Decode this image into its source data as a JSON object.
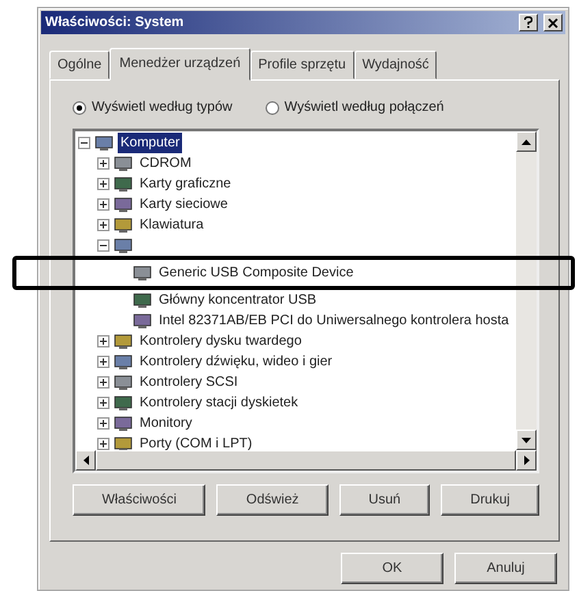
{
  "window": {
    "title": "Właściwości: System"
  },
  "tabs": [
    {
      "label": "Ogólne",
      "selected": false
    },
    {
      "label": "Menedżer urządzeń",
      "selected": true
    },
    {
      "label": "Profile sprzętu",
      "selected": false
    },
    {
      "label": "Wydajność",
      "selected": false
    }
  ],
  "view_options": [
    {
      "label": "Wyświetl według typów",
      "selected": true
    },
    {
      "label": "Wyświetl według połączeń",
      "selected": false
    }
  ],
  "tree": [
    {
      "label": "Komputer",
      "selected": true,
      "expanded": true,
      "children": [
        {
          "label": "CDROM",
          "selected": false,
          "expanded": false
        },
        {
          "label": "Karty graficzne",
          "selected": false,
          "expanded": false
        },
        {
          "label": "Karty sieciowe",
          "selected": false,
          "expanded": false
        },
        {
          "label": "Klawiatura",
          "selected": false,
          "expanded": false
        },
        {
          "expanded": true,
          "children": [
            {
              "label": "Generic USB Composite Device",
              "selected": false
            },
            {
              "label": "Główny koncentrator USB",
              "selected": false
            },
            {
              "label": "Intel 82371AB/EB PCI do Uniwersalnego kontrolera hosta",
              "selected": false
            }
          ]
        },
        {
          "label": "Kontrolery dysku twardego",
          "selected": false,
          "expanded": false
        },
        {
          "label": "Kontrolery dźwięku, wideo i gier",
          "selected": false,
          "expanded": false
        },
        {
          "label": "Kontrolery SCSI",
          "selected": false,
          "expanded": false
        },
        {
          "label": "Kontrolery stacji dyskietek",
          "selected": false,
          "expanded": false
        },
        {
          "label": "Monitory",
          "selected": false,
          "expanded": false
        },
        {
          "label": "Porty (COM i LPT)",
          "selected": false,
          "expanded": false
        }
      ]
    }
  ],
  "tab_buttons": [
    "Właściwości",
    "Odśwież",
    "Usuń",
    "Drukuj"
  ],
  "dialog_buttons": [
    "OK",
    "Anuluj"
  ]
}
